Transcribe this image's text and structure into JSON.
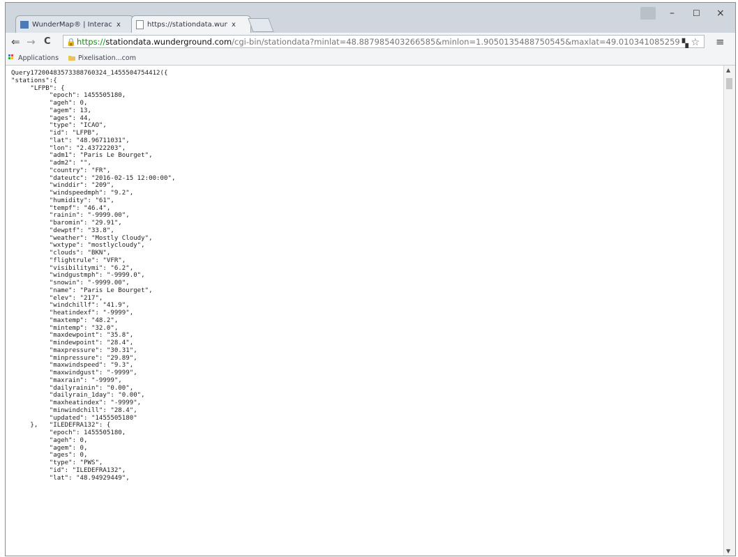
{
  "browser": {
    "tabs": [
      {
        "title": "WunderMap® | Interactiv",
        "close": "x"
      },
      {
        "title": "https://stationdata.wunde",
        "close": "x"
      }
    ],
    "window_controls": {
      "minimize": "–",
      "maximize": "☐",
      "close": "×"
    },
    "nav": {
      "back": "⇐",
      "forward": "→",
      "reload": "C"
    },
    "address": {
      "scheme": "https://",
      "host": "stationdata.wunderground.com",
      "rest": "/cgi-bin/stationdata?minlat=48.887985403266585&minlon=1.9050135488750545&maxlat=49.010341085259",
      "placeholder": ""
    },
    "bookmarks": [
      {
        "label": "Applications",
        "icon": "apps-grid-icon"
      },
      {
        "label": "Pixelisation...com",
        "icon": "folder-icon"
      }
    ]
  },
  "json_view": {
    "lines": [
      "Query17200483573388760324_1455504754412({",
      "\"stations\":{",
      "     \"LFPB\": {",
      "          \"epoch\": 1455505180,",
      "          \"ageh\": 0,",
      "          \"agem\": 13,",
      "          \"ages\": 44,",
      "          \"type\": \"ICAO\",",
      "          \"id\": \"LFPB\",",
      "          \"lat\": \"48.96711031\",",
      "          \"lon\": \"2.43722203\",",
      "          \"adm1\": \"Paris Le Bourget\",",
      "          \"adm2\": \"\",",
      "          \"country\": \"FR\",",
      "          \"dateutc\": \"2016-02-15 12:00:00\",",
      "          \"winddir\": \"209\",",
      "          \"windspeedmph\": \"9.2\",",
      "          \"humidity\": \"61\",",
      "          \"tempf\": \"46.4\",",
      "          \"rainin\": \"-9999.00\",",
      "          \"baromin\": \"29.91\",",
      "          \"dewptf\": \"33.8\",",
      "          \"weather\": \"Mostly Cloudy\",",
      "          \"wxtype\": \"mostlycloudy\",",
      "          \"clouds\": \"BKN\",",
      "          \"flightrule\": \"VFR\",",
      "          \"visibilitymi\": \"6.2\",",
      "          \"windgustmph\": \"-9999.0\",",
      "          \"snowin\": \"-9999.00\",",
      "          \"name\": \"Paris Le Bourget\",",
      "          \"elev\": \"217\",",
      "          \"windchillf\": \"41.9\",",
      "          \"heatindexf\": \"-9999\",",
      "          \"maxtemp\": \"48.2\",",
      "          \"mintemp\": \"32.0\",",
      "          \"maxdewpoint\": \"35.8\",",
      "          \"mindewpoint\": \"28.4\",",
      "          \"maxpressure\": \"30.31\",",
      "          \"minpressure\": \"29.89\",",
      "          \"maxwindspeed\": \"9.3\",",
      "          \"maxwindgust\": \"-9999\",",
      "          \"maxrain\": \"-9999\",",
      "          \"dailyrainin\": \"0.00\",",
      "          \"dailyrain_1day\": \"0.00\",",
      "          \"maxheatindex\": \"-9999\",",
      "          \"minwindchill\": \"28.4\",",
      "          \"updated\": \"1455505180\"",
      "     },   \"ILEDEFRA132\": {",
      "          \"epoch\": 1455505180,",
      "          \"ageh\": 0,",
      "          \"agem\": 0,",
      "          \"ages\": 0,",
      "          \"type\": \"PWS\",",
      "          \"id\": \"ILEDEFRA132\",",
      "          \"lat\": \"48.94929449\","
    ]
  }
}
